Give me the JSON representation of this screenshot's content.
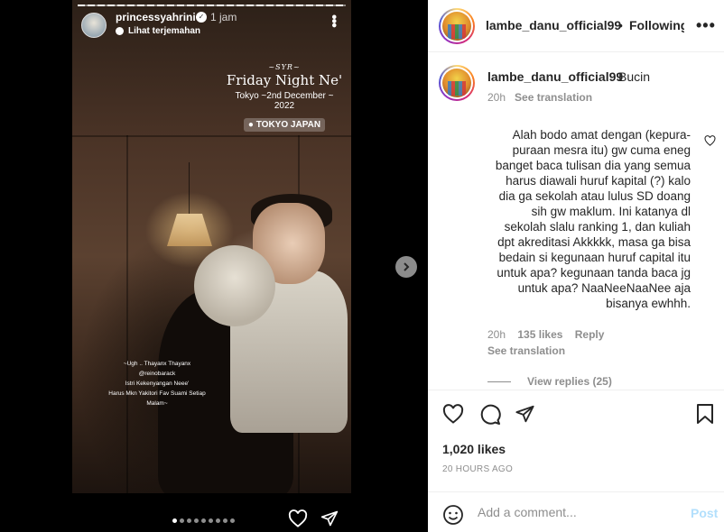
{
  "story": {
    "username": "princessyahrini",
    "time": "1 jam",
    "translate_label": "Lihat terjemahan",
    "overlay": {
      "small": "~SYR~",
      "title": "Friday Night Ne'",
      "date": "Tokyo ~2nd December ~ 2022",
      "location": "TOKYO JAPAN"
    },
    "caption_lines": [
      "~Ugh .. Thayanx Thayanx",
      "@reinobarack",
      "Istri Kekenyangan Neee'",
      "Harus Mkn Yakitori Fav Suami Setiap",
      "Malam~"
    ],
    "slide_count": 9,
    "active_slide": 0
  },
  "post": {
    "username": "lambe_danu_official99",
    "separator": "•",
    "follow_label": "Following",
    "more_label": "•••",
    "caption": {
      "username": "lambe_danu_official99",
      "text": "Bucin",
      "time": "20h",
      "translate_label": "See translation"
    },
    "comment": {
      "text": "Alah bodo amat dengan (kepura-puraan mesra itu) gw cuma eneg banget baca tulisan dia yang semua harus diawali huruf kapital (?) kalo dia ga sekolah atau lulus SD doang sih gw maklum. Ini katanya dl sekolah slalu ranking 1, dan kuliah dpt akreditasi Akkkkk, masa ga bisa bedain si kegunaan huruf capital itu untuk apa? kegunaan tanda baca jg untuk apa? NaaNeeNaaNee aja bisanya ewhhh.",
      "time": "20h",
      "likes": "135 likes",
      "reply_label": "Reply",
      "translate_label": "See translation",
      "view_replies": "View replies (25)"
    },
    "likes": "1,020 likes",
    "timestamp": "20 HOURS AGO",
    "add_comment_placeholder": "Add a comment...",
    "post_button": "Post"
  },
  "colors": {
    "post_button_disabled": "#b2dffc",
    "muted_text": "#8e8e8e",
    "primary_text": "#262626"
  },
  "icons": [
    "verified-icon",
    "more-icon",
    "heart-icon",
    "comment-icon",
    "share-icon",
    "bookmark-icon",
    "emoji-icon",
    "chevron-right-icon",
    "location-pin-icon",
    "translate-icon"
  ]
}
